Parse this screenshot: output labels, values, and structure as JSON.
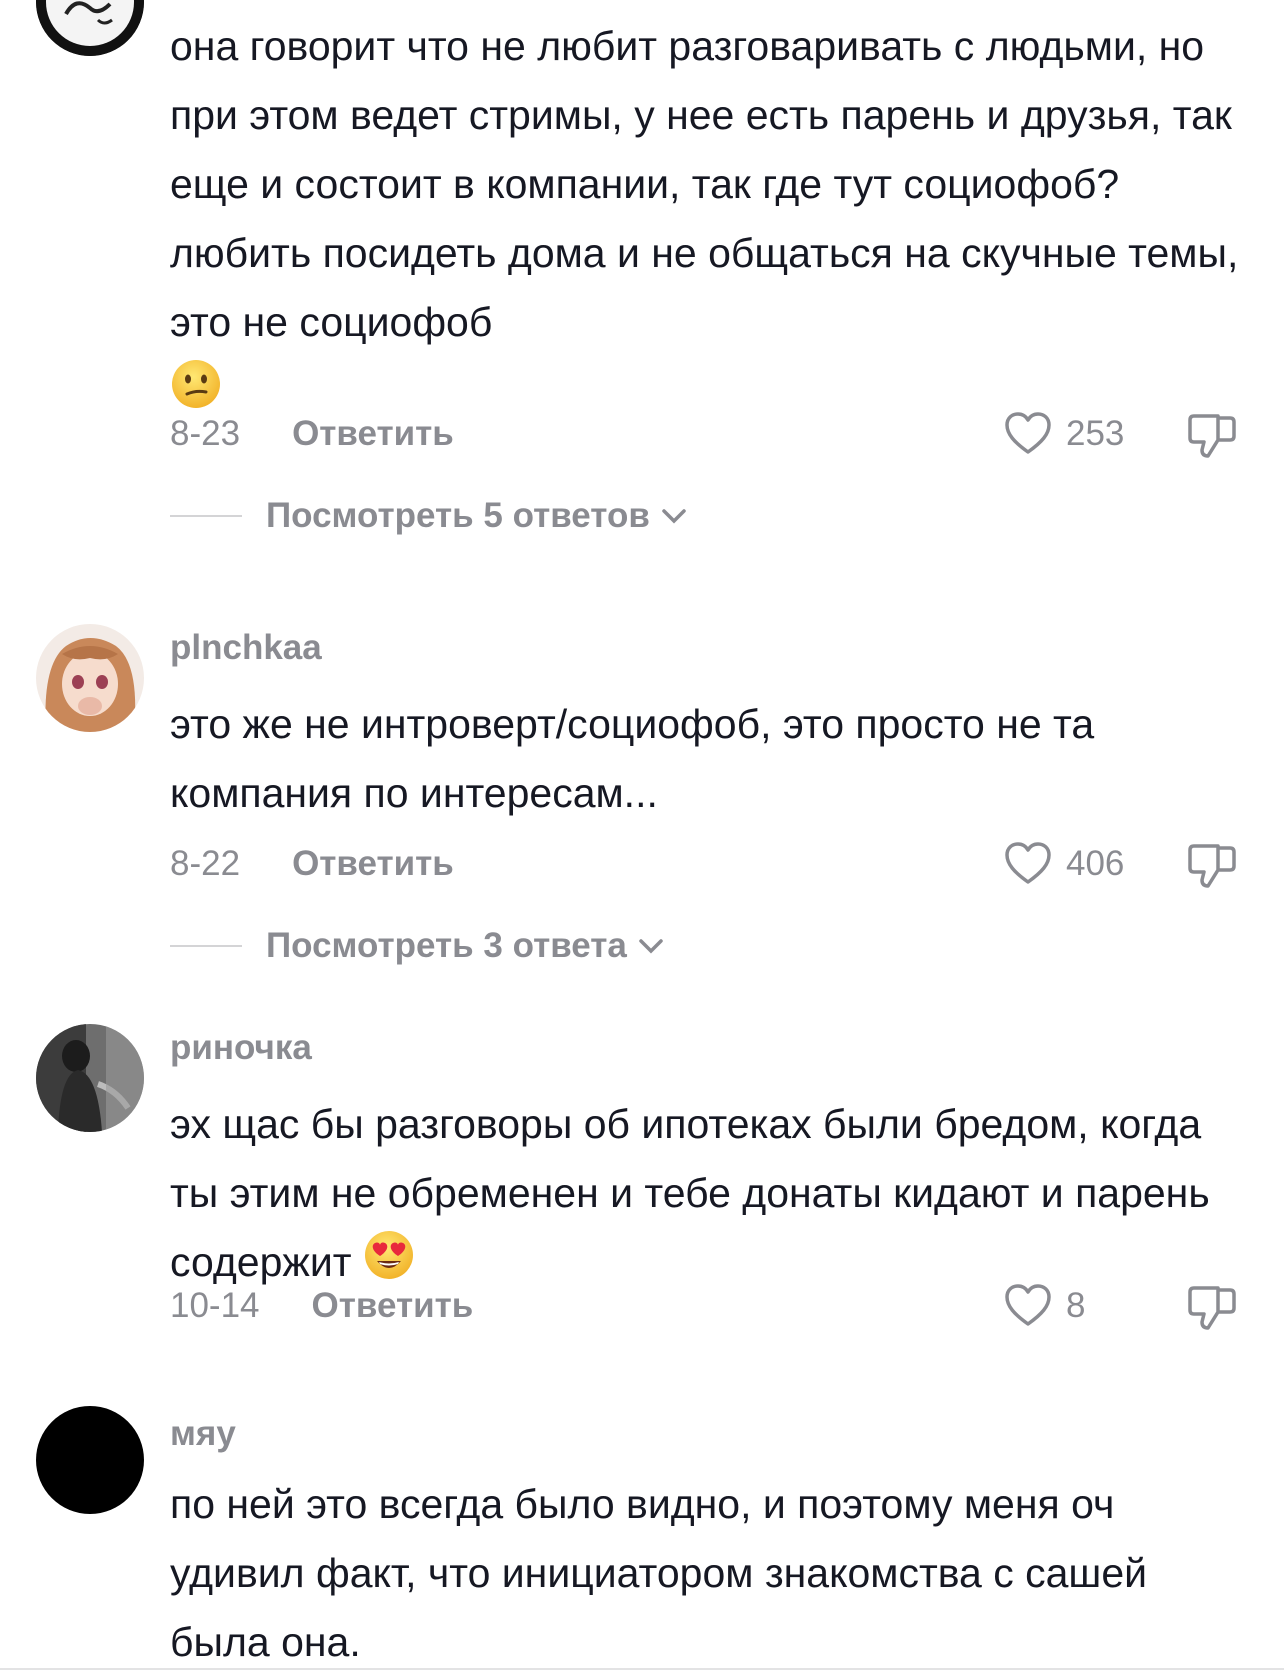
{
  "comments": [
    {
      "username": "",
      "text": "она говорит что не любит разговаривать с людьми, но при этом ведет стримы, у нее есть парень и друзья, так еще и состоит в компании, так где тут социофоб? любить посидеть дома и не общаться на скучные темы, это не социофоб",
      "emoji": "confused-face-emoji",
      "date": "8-23",
      "reply_label": "Ответить",
      "likes": "253",
      "view_replies": "Посмотреть 5 ответов"
    },
    {
      "username": "plnchkaa",
      "text": "это же не интроверт/социофоб, это просто не та компания по интересам...",
      "date": "8-22",
      "reply_label": "Ответить",
      "likes": "406",
      "view_replies": "Посмотреть 3 ответа"
    },
    {
      "username": "риночка",
      "text": "эх щас бы разговоры об ипотеках были бредом, когда ты этим не обременен и тебе донаты кидают и парень содержит",
      "emoji": "heart-eyes-emoji",
      "date": "10-14",
      "reply_label": "Ответить",
      "likes": "8"
    },
    {
      "username": "мяу",
      "text": "по ней это всегда было видно, и поэтому меня оч удивил факт, что инициатором знакомства с сашей была она."
    }
  ],
  "colors": {
    "text": "#161823",
    "muted": "#8a8b91",
    "divider": "#d4d4d6"
  }
}
